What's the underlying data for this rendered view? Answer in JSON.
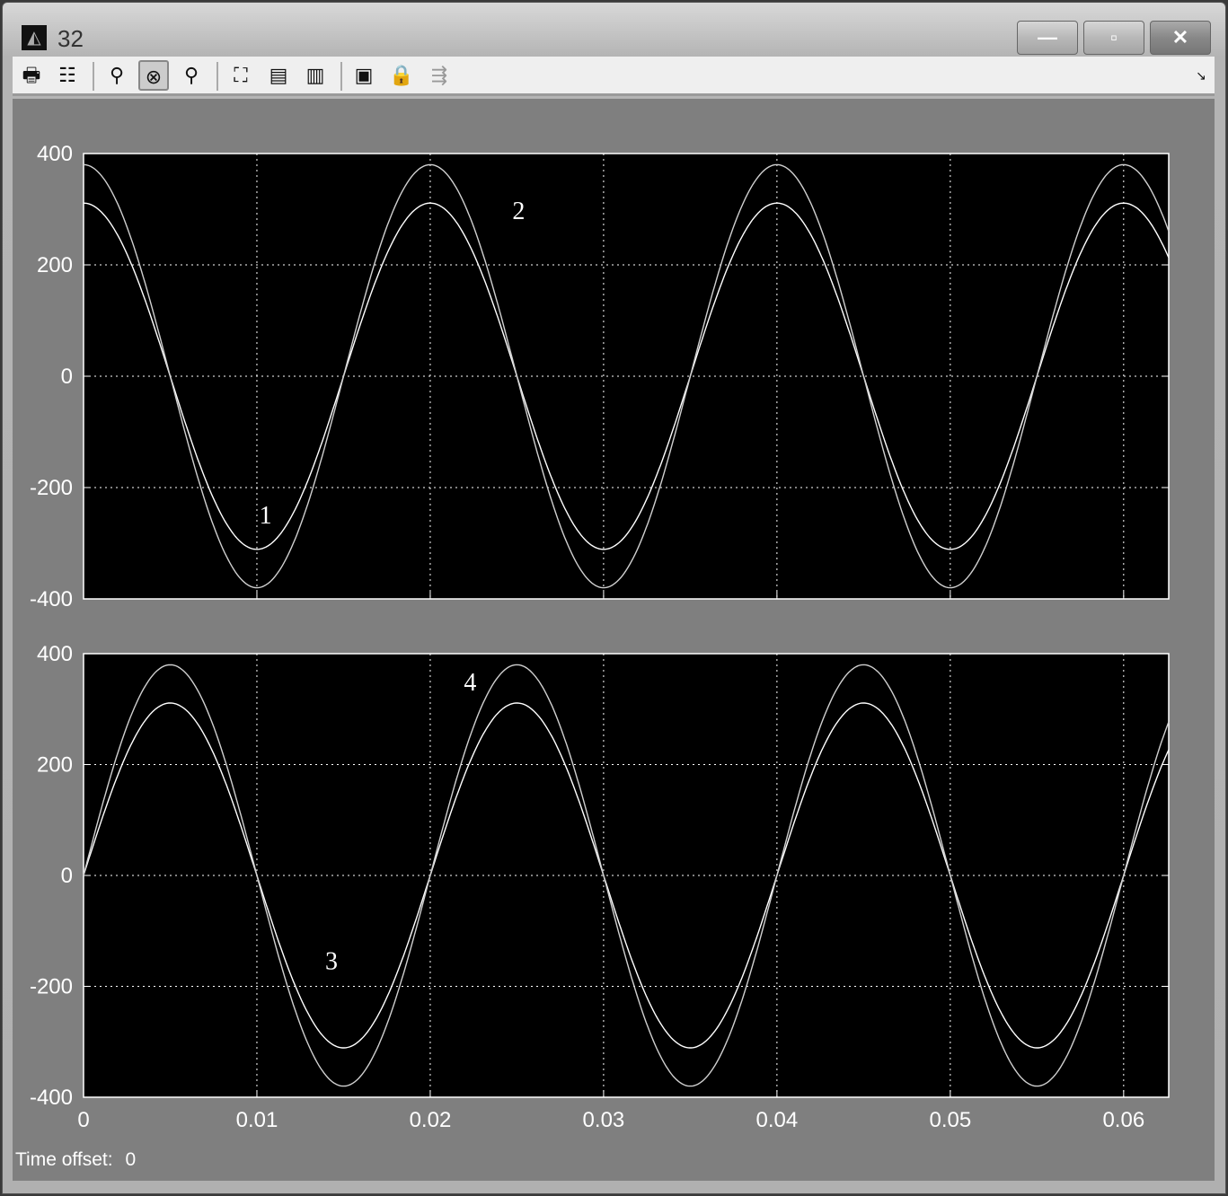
{
  "window": {
    "title": "32",
    "controls": {
      "minimize": "—",
      "maximize": "▫",
      "close": "✕"
    }
  },
  "toolbar": {
    "items": [
      {
        "name": "print",
        "glyph": "🖶"
      },
      {
        "name": "parameters",
        "glyph": "☷"
      },
      {
        "name": "zoom",
        "glyph": "⚲"
      },
      {
        "name": "zoom-x",
        "glyph": "⊗"
      },
      {
        "name": "zoom-y",
        "glyph": "⚲"
      },
      {
        "name": "autoscale",
        "glyph": "⛶"
      },
      {
        "name": "save-axes",
        "glyph": "▤"
      },
      {
        "name": "restore-axes",
        "glyph": "▥"
      },
      {
        "name": "floating-scope",
        "glyph": "▣"
      },
      {
        "name": "lock-axes",
        "glyph": "🔒"
      },
      {
        "name": "signal-selector",
        "glyph": "⇶"
      }
    ],
    "corner_glyph": "↘"
  },
  "status": {
    "label": "Time offset:",
    "value": "0"
  },
  "chart_data": [
    {
      "type": "line",
      "title": "",
      "xlim": [
        0,
        0.0626
      ],
      "ylim": [
        -400,
        400
      ],
      "xticks": [
        0,
        0.01,
        0.02,
        0.03,
        0.04,
        0.05,
        0.06
      ],
      "xtick_labels": [],
      "yticks": [
        -400,
        -200,
        0,
        200,
        400
      ],
      "ytick_labels": [
        "-400",
        "-200",
        "0",
        "200",
        "400"
      ],
      "grid": true,
      "series": [
        {
          "name": "1",
          "function": "cos",
          "amplitude": 311,
          "frequency_hz": 50,
          "color": "#ffffff"
        },
        {
          "name": "2",
          "function": "cos",
          "amplitude": 380,
          "frequency_hz": 50,
          "color": "#d0d0d0"
        }
      ],
      "annotations": [
        {
          "text": "1",
          "x": 0.0105,
          "y": -248
        },
        {
          "text": "2",
          "x": 0.0251,
          "y": 298
        }
      ]
    },
    {
      "type": "line",
      "title": "",
      "xlim": [
        0,
        0.0626
      ],
      "ylim": [
        -400,
        400
      ],
      "xticks": [
        0,
        0.01,
        0.02,
        0.03,
        0.04,
        0.05,
        0.06
      ],
      "xtick_labels": [
        "0",
        "0.01",
        "0.02",
        "0.03",
        "0.04",
        "0.05",
        "0.06"
      ],
      "yticks": [
        -400,
        -200,
        0,
        200,
        400
      ],
      "ytick_labels": [
        "-400",
        "-200",
        "0",
        "200",
        "400"
      ],
      "grid": true,
      "series": [
        {
          "name": "3",
          "function": "sin",
          "amplitude": 311,
          "frequency_hz": 50,
          "color": "#ffffff"
        },
        {
          "name": "4",
          "function": "sin",
          "amplitude": 380,
          "frequency_hz": 50,
          "color": "#d0d0d0"
        }
      ],
      "annotations": [
        {
          "text": "3",
          "x": 0.0143,
          "y": -153
        },
        {
          "text": "4",
          "x": 0.0223,
          "y": 350
        }
      ]
    }
  ]
}
